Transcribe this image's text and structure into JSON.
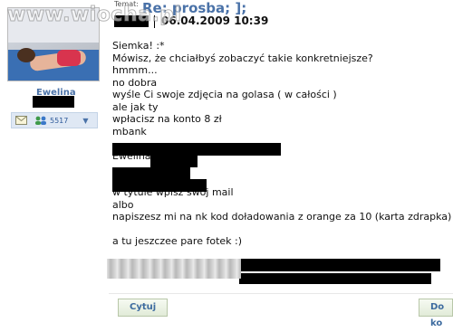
{
  "watermark": "www.wiocha.pl",
  "user": {
    "name": "Ewelina",
    "posts": "5517"
  },
  "post": {
    "subject_label": "Temat:",
    "subject": "Re: prosba; ];",
    "date": "06.04.2009 10:39",
    "lines": [
      "Siemka! :*",
      "Mówisz, że chciałbyś zobaczyć takie konkretniejsze?",
      "hmmm...",
      "no dobra",
      "wyśle Ci swoje zdjęcia na golasa ( w całości )",
      "ale jak ty",
      "wpłacisz na konto 8 zł",
      "mbank",
      "",
      "Ewelina",
      "",
      "",
      "w tytule wpisz swój mail",
      "albo",
      "napiszesz mi na nk kod doładowania z orange za 10 (karta zdrapka)",
      "",
      "a tu jeszczee pare fotek :)"
    ]
  },
  "buttons": {
    "quote": "Cytuj",
    "next": "Do ko"
  }
}
